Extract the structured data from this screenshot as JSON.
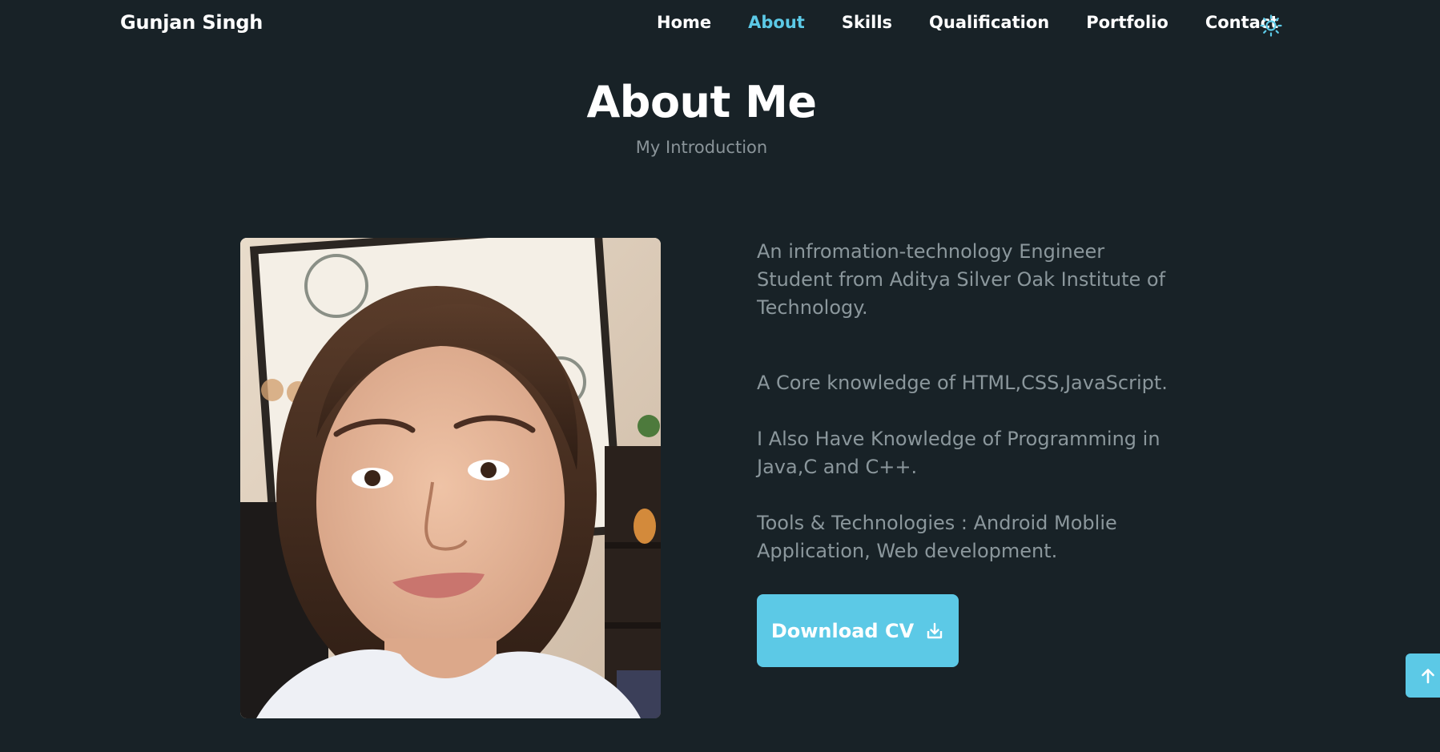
{
  "header": {
    "brand": "Gunjan Singh",
    "nav": [
      {
        "label": "Home",
        "active": false
      },
      {
        "label": "About",
        "active": true
      },
      {
        "label": "Skills",
        "active": false
      },
      {
        "label": "Qualification",
        "active": false
      },
      {
        "label": "Portfolio",
        "active": false
      },
      {
        "label": "Contact",
        "active": false
      }
    ],
    "theme_icon": "sun-icon"
  },
  "section": {
    "title": "About Me",
    "subtitle": "My Introduction"
  },
  "about": {
    "paragraphs": [
      "An infromation-technology Engineer Student from Aditya Silver Oak Institute of Technology.",
      "A Core knowledge of HTML,CSS,JavaScript.",
      "I Also Have Knowledge of Programming in Java,C and C++.",
      "Tools & Technologies : Android Moblie Application, Web development."
    ],
    "download_label": "Download CV",
    "download_icon": "download-icon"
  },
  "scroll_top_icon": "arrow-up-icon",
  "colors": {
    "background": "#182227",
    "accent": "#5cc9e6",
    "muted_text": "#8b979c"
  }
}
